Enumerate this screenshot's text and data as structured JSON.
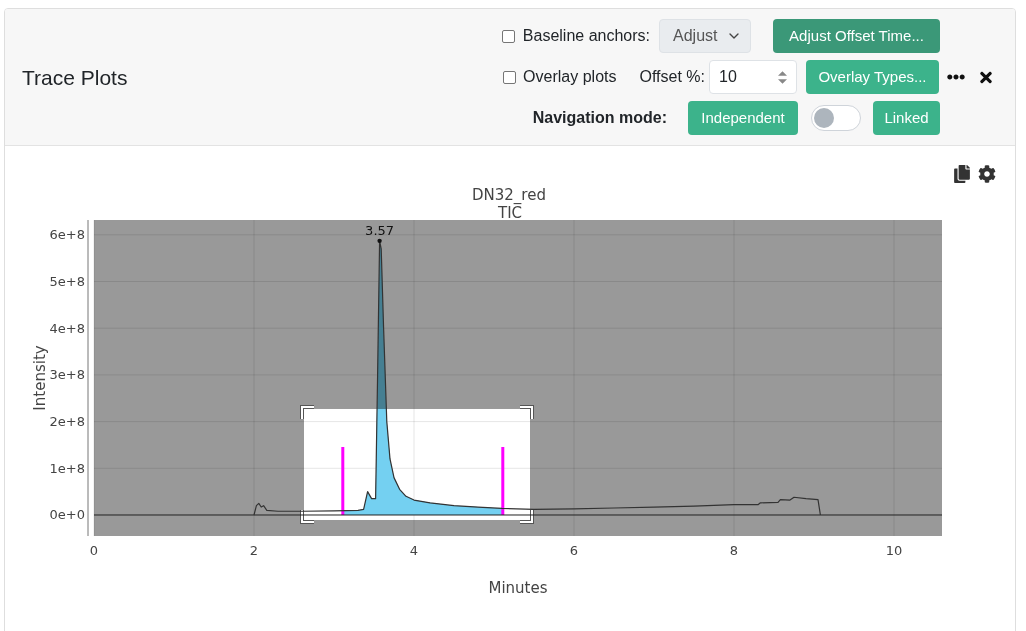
{
  "panel": {
    "title": "Trace Plots"
  },
  "controls": {
    "baseline_anchors": {
      "label": "Baseline anchors:",
      "checked": false
    },
    "baseline_mode": {
      "value": "Adjust"
    },
    "adjust_offset_button": {
      "label": "Adjust Offset Time...",
      "active": true
    },
    "overlay_plots": {
      "label": "Overlay plots",
      "checked": false
    },
    "offset": {
      "label": "Offset %:",
      "value": "10"
    },
    "overlay_types_button": {
      "label": "Overlay Types...",
      "active": false
    },
    "navigation": {
      "label": "Navigation mode:",
      "independent_button": {
        "label": "Independent",
        "active": false
      },
      "linked": false,
      "linked_button": {
        "label": "Linked",
        "active": false
      }
    }
  },
  "plot": {
    "chart_data": {
      "type": "line",
      "title": "DN32_red",
      "xlabel": "Minutes",
      "ylabel": "Intensity",
      "x": [
        2.0,
        2.03,
        2.06,
        2.09,
        2.12,
        2.16,
        2.3,
        2.6,
        3.0,
        3.3,
        3.37,
        3.42,
        3.47,
        3.52,
        3.545,
        3.57,
        3.59,
        3.62,
        3.66,
        3.7,
        3.75,
        3.82,
        3.9,
        4.0,
        4.2,
        4.5,
        4.8,
        5.1,
        5.5,
        6.0,
        6.5,
        7.0,
        7.5,
        8.0,
        8.3,
        8.33,
        8.55,
        8.58,
        8.7,
        8.75,
        8.9,
        9.05,
        9.08
      ],
      "series": [
        {
          "name": "TIC",
          "color": "#333333",
          "values": [
            0,
            20000000,
            25000000,
            17000000,
            20000000,
            10000000,
            8000000,
            8000000,
            9000000,
            10000000,
            12000000,
            50000000,
            35000000,
            35000000,
            300000000,
            587000000,
            570000000,
            400000000,
            200000000,
            120000000,
            80000000,
            55000000,
            40000000,
            32000000,
            26000000,
            20000000,
            17000000,
            14000000,
            12000000,
            13000000,
            15000000,
            17000000,
            19000000,
            22000000,
            22000000,
            26000000,
            27000000,
            33000000,
            32000000,
            38000000,
            35000000,
            33000000,
            0
          ]
        }
      ],
      "xlim": [
        0,
        10.6
      ],
      "ylim": [
        -45000000,
        631700000
      ],
      "xticks": [
        0,
        2,
        4,
        6,
        8,
        10
      ],
      "yticks": [
        {
          "value": 0,
          "label": "0e+0"
        },
        {
          "value": 100000000,
          "label": "1e+8"
        },
        {
          "value": 200000000,
          "label": "2e+8"
        },
        {
          "value": 300000000,
          "label": "3e+8"
        },
        {
          "value": 400000000,
          "label": "4e+8"
        },
        {
          "value": 500000000,
          "label": "5e+8"
        },
        {
          "value": 600000000,
          "label": "6e+8"
        }
      ],
      "grid": true,
      "annotations": [
        {
          "x": 3.57,
          "y": 587000000,
          "text": "3.57"
        }
      ],
      "ref_lines": [
        {
          "axis": "x",
          "value": 3.11,
          "color": "#ff00ff"
        },
        {
          "axis": "x",
          "value": 5.11,
          "color": "#ff00ff"
        }
      ],
      "bands": [
        {
          "axis": "x",
          "from": 2.625,
          "to": 5.45
        }
      ]
    }
  }
}
